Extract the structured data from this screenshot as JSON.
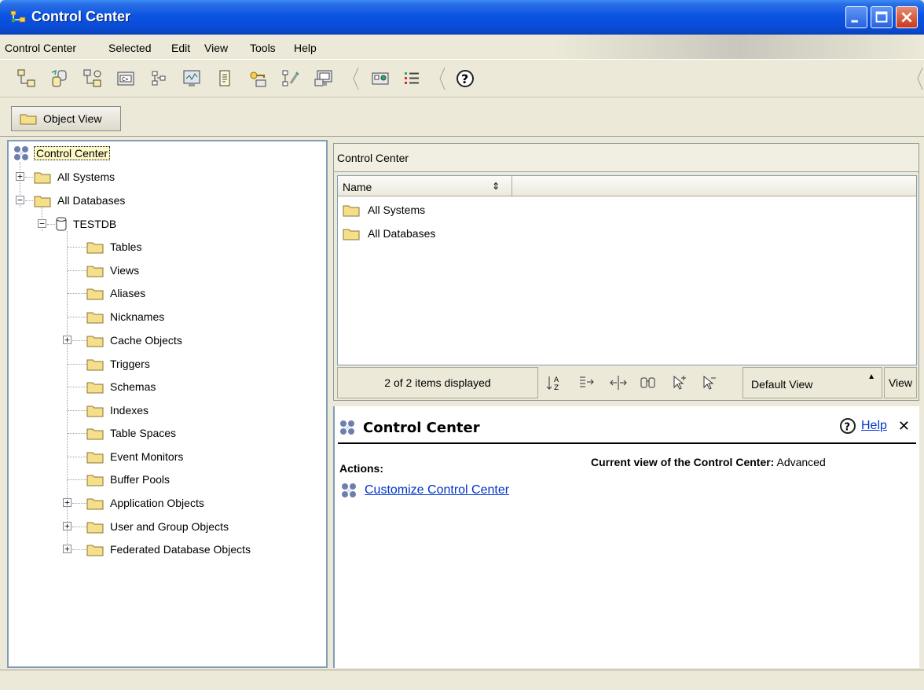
{
  "window": {
    "title": "Control Center"
  },
  "menubar": {
    "items": [
      "Control Center",
      "Selected",
      "Edit",
      "View",
      "Tools",
      "Help"
    ]
  },
  "toolbar": {
    "icons": [
      "system-tree-icon",
      "replication-icon",
      "satellite-icon",
      "command-editor-icon",
      "task-center-icon",
      "health-center-icon",
      "journal-icon",
      "license-center-icon",
      "dev-center-icon",
      "tools-settings-icon",
      "legend-icon",
      "list-view-icon",
      "help-icon"
    ]
  },
  "viewbar": {
    "object_view_label": "Object View"
  },
  "tree": {
    "root": "Control Center",
    "all_systems": "All Systems",
    "all_databases": "All Databases",
    "db": "TESTDB",
    "children": [
      "Tables",
      "Views",
      "Aliases",
      "Nicknames",
      "Cache Objects",
      "Triggers",
      "Schemas",
      "Indexes",
      "Table Spaces",
      "Event Monitors",
      "Buffer Pools",
      "Application Objects",
      "User and Group Objects",
      "Federated Database Objects"
    ]
  },
  "contents": {
    "header": "Control Center",
    "column_name": "Name",
    "rows": [
      "All Systems",
      "All Databases"
    ],
    "items_count": "2 of 2 items displayed",
    "view_combo": "Default View",
    "view_button": "View"
  },
  "info": {
    "title": "Control Center",
    "help": "Help",
    "close": "✕",
    "actions_label": "Actions:",
    "current_view_label": "Current view of the Control Center:",
    "current_view_value": "Advanced",
    "action_link": "Customize Control Center"
  },
  "colors": {
    "title_bar": "#0A54E3",
    "link": "#0033CC",
    "folder": "#F5DF8A",
    "selection": "#FDF8C5"
  }
}
